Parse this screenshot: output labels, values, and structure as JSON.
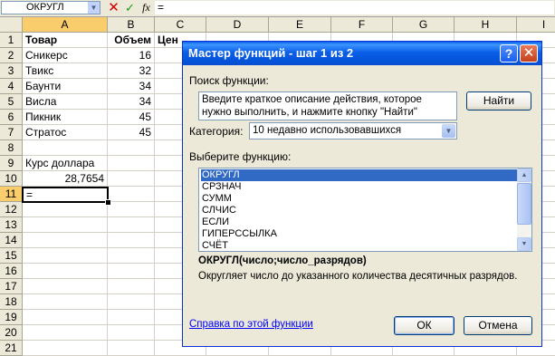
{
  "formula_bar": {
    "name_box": "ОКРУГЛ",
    "cancel_icon": "✕",
    "enter_icon": "✓",
    "fx_label": "fx",
    "formula": "="
  },
  "columns": [
    "A",
    "B",
    "C",
    "D",
    "E",
    "F",
    "G",
    "H",
    "I"
  ],
  "rows": [
    "1",
    "2",
    "3",
    "4",
    "5",
    "6",
    "7",
    "8",
    "9",
    "10",
    "11",
    "12",
    "13",
    "14",
    "15",
    "16",
    "17",
    "18",
    "19",
    "20",
    "21"
  ],
  "cells": {
    "A1": "Товар",
    "B1": "Объем",
    "C1": "Цен",
    "A2": "Сникерс",
    "B2": "16",
    "A3": "Твикс",
    "B3": "32",
    "A4": "Баунти",
    "B4": "34",
    "A5": "Висла",
    "B5": "34",
    "A6": "Пикник",
    "B6": "45",
    "A7": "Стратос",
    "B7": "45",
    "A9": "Курс доллара",
    "A10": "28,7654",
    "A11": "="
  },
  "dialog": {
    "title": "Мастер функций - шаг 1 из 2",
    "help_icon": "?",
    "close_icon": "✕",
    "search_label": "Поиск функции:",
    "search_text": "Введите краткое описание действия, которое нужно выполнить, и нажмите кнопку \"Найти\"",
    "find_button": "Найти",
    "category_label": "Категория:",
    "category_value": "10 недавно использовавшихся",
    "select_label": "Выберите функцию:",
    "functions": [
      "ОКРУГЛ",
      "СРЗНАЧ",
      "СУММ",
      "СЛЧИС",
      "ЕСЛИ",
      "ГИПЕРССЫЛКА",
      "СЧЁТ"
    ],
    "selected_function": "ОКРУГЛ",
    "signature": "ОКРУГЛ(число;число_разрядов)",
    "description": "Округляет число до указанного количества десятичных разрядов.",
    "help_link": "Справка по этой функции",
    "ok_button": "ОК",
    "cancel_button": "Отмена"
  }
}
